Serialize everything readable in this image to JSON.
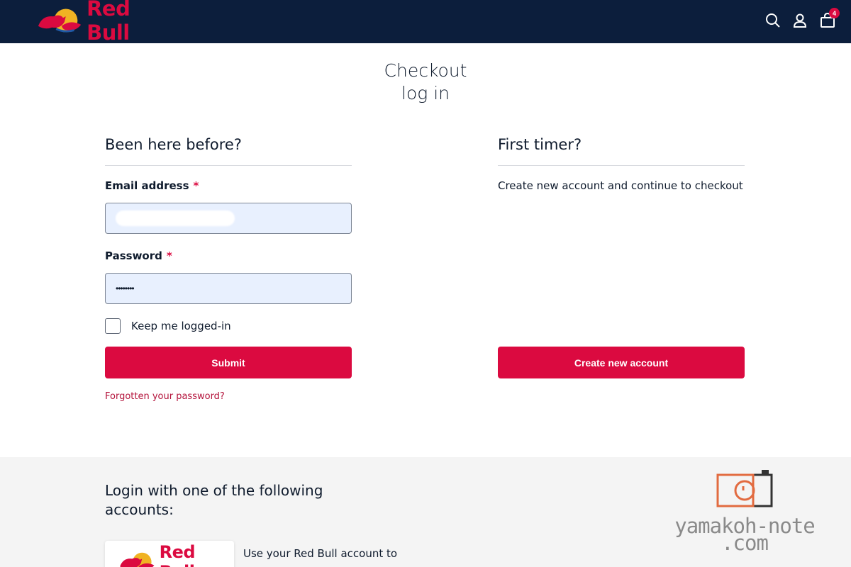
{
  "header": {
    "brand": "Red Bull",
    "icons": [
      "search-icon",
      "user-icon",
      "cart-icon"
    ],
    "cart_count": "4"
  },
  "page": {
    "title_line1": "Checkout",
    "title_line2": "log in"
  },
  "login": {
    "heading": "Been here before?",
    "email_label": "Email address",
    "password_label": "Password",
    "required_mark": "*",
    "password_value": "••••••••",
    "keep_logged_label": "Keep me logged-in",
    "submit_label": "Submit",
    "forgot_link": "Forgotten your password?"
  },
  "register": {
    "heading": "First timer?",
    "description": "Create new account and continue to checkout",
    "create_label": "Create new account"
  },
  "social": {
    "heading": "Login with one of the following accounts:",
    "provider_brand": "Red Bull",
    "description": "Use your Red Bull account to"
  },
  "watermark": {
    "text": "yamakoh-note\n.com"
  },
  "colors": {
    "header_bg": "#0c1e3c",
    "brand_red": "#db0a40",
    "input_bg": "#e8f0fe",
    "band_bg": "#f4f4f4"
  }
}
